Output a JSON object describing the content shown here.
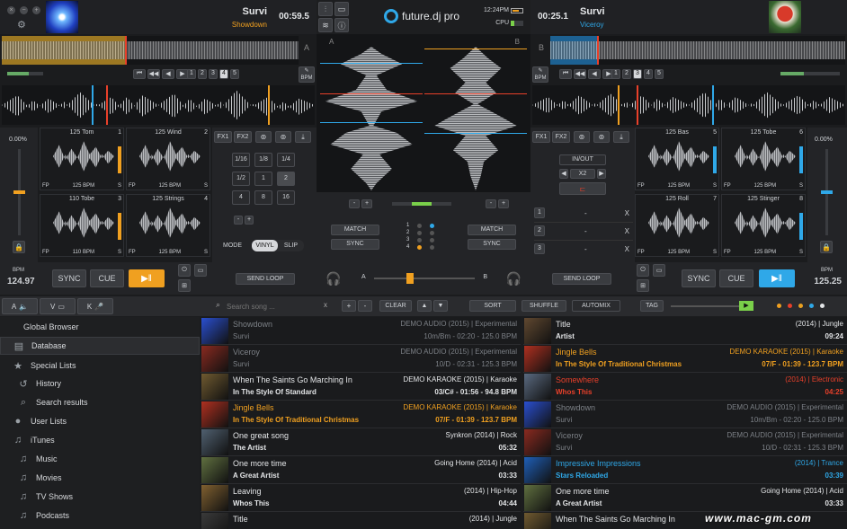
{
  "deck_left": {
    "title": "Survi",
    "artist": "Showdown",
    "time": "00:59.5",
    "bpm_label": "BPM",
    "bpm_value": "124.97",
    "pitch": "0.00%",
    "pages": [
      "1",
      "2",
      "3",
      "4",
      "5"
    ],
    "active_page": "4",
    "sync": "SYNC",
    "cue": "CUE",
    "fx1": "FX1",
    "fx2": "FX2",
    "mode": "MODE",
    "vinyl": "VINYL",
    "slip": "SLIP",
    "send_loop": "SEND LOOP",
    "loops": [
      "1/16",
      "1/8",
      "1/4",
      "1/2",
      "1",
      "2",
      "4",
      "8",
      "16"
    ],
    "samples": [
      {
        "name": "125 Tom",
        "num": "1",
        "bpm": "125",
        "bpm_unit": "BPM"
      },
      {
        "name": "125 Wind",
        "num": "2",
        "bpm": "125",
        "bpm_unit": "BPM"
      },
      {
        "name": "110 Tobe",
        "num": "3",
        "bpm": "110",
        "bpm_unit": "BPM"
      },
      {
        "name": "125 Strings",
        "num": "4",
        "bpm": "125",
        "bpm_unit": "BPM"
      }
    ],
    "fp": "FP",
    "s": "S"
  },
  "deck_right": {
    "title": "Survi",
    "artist": "Viceroy",
    "time": "00:25.1",
    "bpm_label": "BPM",
    "bpm_value": "125.25",
    "pitch": "0.00%",
    "pages": [
      "1",
      "2",
      "3",
      "4",
      "5"
    ],
    "active_page": "3",
    "sync": "SYNC",
    "cue": "CUE",
    "fx1": "FX1",
    "fx2": "FX2",
    "inout": "IN/OUT",
    "x2": "X2",
    "send_loop": "SEND LOOP",
    "cue_slots": [
      "1",
      "2",
      "3"
    ],
    "cue_dash": "-",
    "cue_x": "X",
    "samples": [
      {
        "name": "125 Bas",
        "num": "5",
        "bpm": "125",
        "bpm_unit": "BPM"
      },
      {
        "name": "125 Tobe",
        "num": "6",
        "bpm": "125",
        "bpm_unit": "BPM"
      },
      {
        "name": "125 Roll",
        "num": "7",
        "bpm": "125",
        "bpm_unit": "BPM"
      },
      {
        "name": "125 Stinger",
        "num": "8",
        "bpm": "125",
        "bpm_unit": "BPM"
      }
    ],
    "fp": "FP",
    "s": "S"
  },
  "center": {
    "logo": "future.dj pro",
    "clock": "12:24PM",
    "cpu": "CPU",
    "deck_a": "A",
    "deck_b": "B",
    "match": "MATCH",
    "sync": "SYNC",
    "steps": [
      "1",
      "2",
      "3",
      "4"
    ]
  },
  "toolbar": {
    "mode_a": "A",
    "mode_v": "V",
    "mode_k": "K",
    "search_placeholder": "Search song ...",
    "search_clear_x": "x",
    "plus": "+",
    "minus": "-",
    "clear": "CLEAR",
    "sort": "SORT",
    "shuffle": "SHUFFLE",
    "automix": "AUTOMIX",
    "tag": "TAG"
  },
  "sidebar": {
    "title": "Global Browser",
    "items": [
      {
        "label": "Database",
        "icon": "database-icon",
        "indent": 0,
        "selected": true
      },
      {
        "label": "Special Lists",
        "icon": "star-icon",
        "indent": 0
      },
      {
        "label": "History",
        "icon": "history-icon",
        "indent": 1
      },
      {
        "label": "Search results",
        "icon": "search-icon",
        "indent": 1
      },
      {
        "label": "User Lists",
        "icon": "user-icon",
        "indent": 0
      },
      {
        "label": "iTunes",
        "icon": "itunes-icon",
        "indent": 0
      },
      {
        "label": "Music",
        "icon": "music-icon",
        "indent": 1
      },
      {
        "label": "Movies",
        "icon": "movies-icon",
        "indent": 1
      },
      {
        "label": "TV Shows",
        "icon": "tv-icon",
        "indent": 1
      },
      {
        "label": "Podcasts",
        "icon": "podcast-icon",
        "indent": 1
      }
    ]
  },
  "list_left": [
    {
      "title": "Showdown",
      "artist": "Survi",
      "meta": "DEMO AUDIO (2015) | Experimental",
      "info": "10m/Bm - 02:20 - 125.0 BPM",
      "state": "played",
      "art": "#2a4fd0"
    },
    {
      "title": "Viceroy",
      "artist": "Survi",
      "meta": "DEMO AUDIO (2015) | Experimental",
      "info": "10/D - 02:31 - 125.3 BPM",
      "state": "played",
      "art": "#8a2a20"
    },
    {
      "title": "When The Saints Go Marching In",
      "artist": "In The Style Of Standard",
      "meta": "DEMO KARAOKE (2015) | Karaoke",
      "info": "03/C# - 01:56 - 94.8 BPM",
      "state": "normal",
      "art": "#705a30"
    },
    {
      "title": "Jingle Bells",
      "artist": "In The Style Of Traditional Christmas",
      "meta": "DEMO KARAOKE (2015) | Karaoke",
      "info": "07/F - 01:39 - 123.7 BPM",
      "state": "orange",
      "art": "#b03020"
    },
    {
      "title": "One great song",
      "artist": "The Artist",
      "meta": "Synkron (2014) | Rock",
      "info": "05:32",
      "state": "normal",
      "art": "#506070"
    },
    {
      "title": "One more time",
      "artist": "A Great Artist",
      "meta": "Going Home (2014) | Acid",
      "info": "03:33",
      "state": "normal",
      "art": "#607040"
    },
    {
      "title": "Leaving",
      "artist": "Whos This",
      "meta": "(2014) | Hip-Hop",
      "info": "04:44",
      "state": "normal",
      "art": "#806030"
    },
    {
      "title": "Title",
      "artist": "",
      "meta": "(2014) | Jungle",
      "info": "",
      "state": "normal",
      "art": "#3a3a3a"
    }
  ],
  "list_right": [
    {
      "title": "Title",
      "artist": "Artist",
      "meta": "(2014) | Jungle",
      "info": "09:24",
      "state": "normal",
      "art": "#604830"
    },
    {
      "title": "Jingle Bells",
      "artist": "In The Style Of Traditional Christmas",
      "meta": "DEMO KARAOKE (2015) | Karaoke",
      "info": "07/F - 01:39 - 123.7 BPM",
      "state": "orange",
      "art": "#b03020"
    },
    {
      "title": "Somewhere",
      "artist": "Whos This",
      "meta": "(2014) | Electronic",
      "info": "04:25",
      "state": "red",
      "art": "#5a6a80"
    },
    {
      "title": "Showdown",
      "artist": "Survi",
      "meta": "DEMO AUDIO (2015) | Experimental",
      "info": "10m/Bm - 02:20 - 125.0 BPM",
      "state": "played",
      "art": "#2a4fd0"
    },
    {
      "title": "Viceroy",
      "artist": "Survi",
      "meta": "DEMO AUDIO (2015) | Experimental",
      "info": "10/D - 02:31 - 125.3 BPM",
      "state": "played",
      "art": "#8a2a20"
    },
    {
      "title": "Impressive Impressions",
      "artist": "Stars Reloaded",
      "meta": "(2014) | Trance",
      "info": "03:39",
      "state": "blue",
      "art": "#1f5fb8"
    },
    {
      "title": "One more time",
      "artist": "A Great Artist",
      "meta": "Going Home (2014) | Acid",
      "info": "03:33",
      "state": "normal",
      "art": "#607040"
    },
    {
      "title": "When The Saints Go Marching In",
      "artist": "",
      "meta": "",
      "info": "",
      "state": "normal",
      "art": "#705a30"
    }
  ],
  "watermark": "www.mac-gm.com",
  "colors": {
    "orange": "#f0a020",
    "blue": "#2fa8e8",
    "red": "#e8402a"
  }
}
